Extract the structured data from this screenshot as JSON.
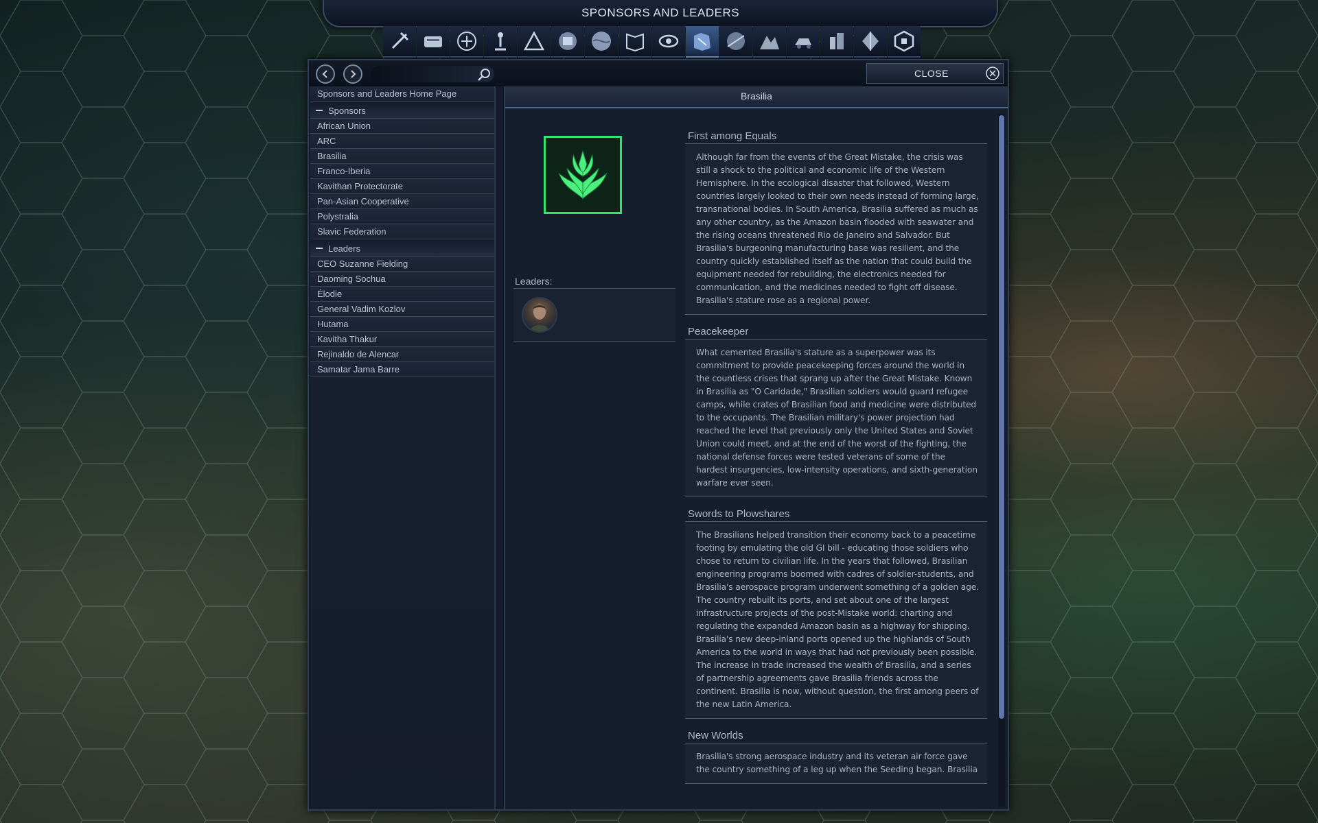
{
  "window": {
    "title": "SPONSORS AND LEADERS"
  },
  "toolbar": {
    "icons": [
      "tool-icon",
      "vault-icon",
      "network-icon",
      "person-icon",
      "tent-icon",
      "satellite-icon",
      "planet-icon",
      "book-icon",
      "eye-icon",
      "map-icon",
      "orbit-icon",
      "terrain-icon",
      "vehicle-icon",
      "building-icon",
      "crystal-icon",
      "affinity-icon"
    ],
    "active_index": 9
  },
  "nav": {
    "search_placeholder": "",
    "close_label": "CLOSE"
  },
  "sidebar": {
    "home": "Sponsors and Leaders Home Page",
    "sponsors_header": "Sponsors",
    "sponsors": [
      "African Union",
      "ARC",
      "Brasilia",
      "Franco-Iberia",
      "Kavithan Protectorate",
      "Pan-Asian Cooperative",
      "Polystralia",
      "Slavic Federation"
    ],
    "leaders_header": "Leaders",
    "leaders": [
      "CEO Suzanne Fielding",
      "Daoming Sochua",
      "Élodie",
      "General Vadim Kozlov",
      "Hutama",
      "Kavitha Thakur",
      "Rejinaldo de Alencar",
      "Samatar Jama Barre"
    ]
  },
  "content": {
    "title": "Brasilia",
    "leaders_label": "Leaders:",
    "emblem_color": "#36e36a",
    "sections": [
      {
        "heading": "First among Equals",
        "body": "Although far from the events of the Great Mistake, the crisis was still a shock to the political and economic life of the Western Hemisphere. In the ecological disaster that followed, Western countries largely looked to their own needs instead of forming large, transnational bodies. In South America, Brasilia suffered as much as any other country, as the Amazon basin flooded with seawater and the rising oceans threatened Rio de Janeiro and Salvador. But Brasilia's burgeoning manufacturing base was resilient, and the country quickly established itself as the nation that could build the equipment needed for rebuilding, the electronics needed for communication, and the medicines needed to fight off disease. Brasilia's stature rose as a regional power."
      },
      {
        "heading": "Peacekeeper",
        "body": "What cemented Brasilia's stature as a superpower was its commitment to provide peacekeeping forces around the world in the countless crises that sprang up after the Great Mistake. Known in Brasilia as \"O Caridade,\" Brasilian soldiers would guard refugee camps, while crates of Brasilian food and medicine were distributed to the occupants. The Brasilian military's power projection had reached the level that previously only the United States and Soviet Union could meet, and at the end of the worst of the fighting, the national defense forces were tested veterans of some of the hardest insurgencies, low-intensity operations, and sixth-generation warfare ever seen."
      },
      {
        "heading": "Swords to Plowshares",
        "body": "The Brasilians helped transition their economy back to a peacetime footing by emulating the old GI bill - educating those soldiers who chose to return to civilian life. In the years that followed, Brasilian engineering programs boomed with cadres of soldier-students, and Brasilia's aerospace program underwent something of a golden age. The country rebuilt its ports, and set about one of the largest infrastructure projects of the post-Mistake world: charting and regulating the expanded Amazon basin as a highway for shipping. Brasilia's new deep-inland ports opened up the highlands of South America to the world in ways that had not previously been possible. The increase in trade increased the wealth of Brasilia, and a series of partnership agreements gave Brasilia friends across the continent. Brasilia is now, without question, the first among peers of the new Latin America."
      },
      {
        "heading": "New Worlds",
        "body": "Brasilia's strong aerospace industry and its veteran air force gave the country something of a leg up when the Seeding began. Brasilia"
      }
    ]
  }
}
